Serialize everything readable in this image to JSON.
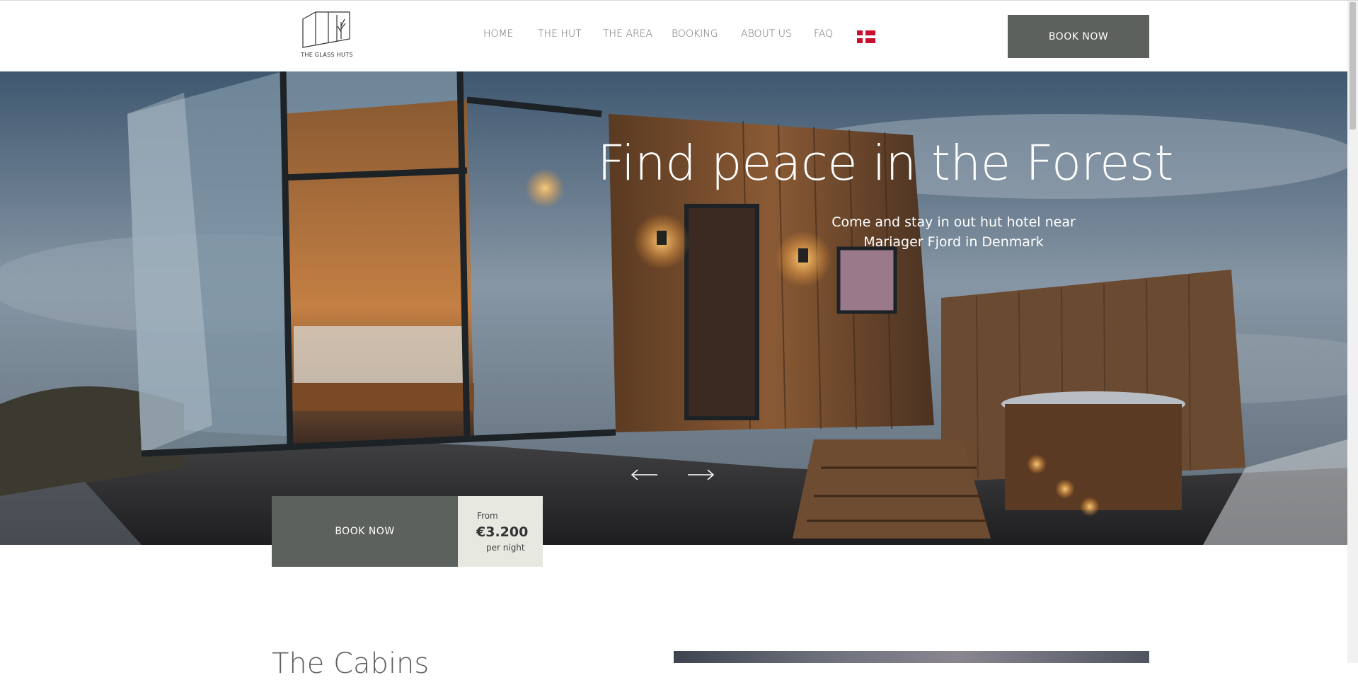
{
  "header": {
    "logo_text": "THE GLASS HUTS",
    "nav": [
      {
        "label": "HOME"
      },
      {
        "label": "THE HUT"
      },
      {
        "label": "THE AREA"
      },
      {
        "label": "BOOKING"
      },
      {
        "label": "ABOUT US"
      },
      {
        "label": "FAQ"
      }
    ],
    "language_flag": "danish-flag-icon",
    "book_button": "BOOK NOW"
  },
  "hero": {
    "title": "Find peace in the Forest",
    "subtitle_line1": "Come and stay in out hut hotel near",
    "subtitle_line2": "Mariager Fjord in Denmark",
    "prev_icon": "arrow-left-icon",
    "next_icon": "arrow-right-icon"
  },
  "booking": {
    "button": "BOOK NOW",
    "from": "From",
    "price": "€3.200",
    "per": "per night"
  },
  "section": {
    "title": "The Cabins"
  },
  "colors": {
    "accent": "#5c615d",
    "price_bg": "#e7e9e1",
    "flag_red": "#c8102e"
  }
}
